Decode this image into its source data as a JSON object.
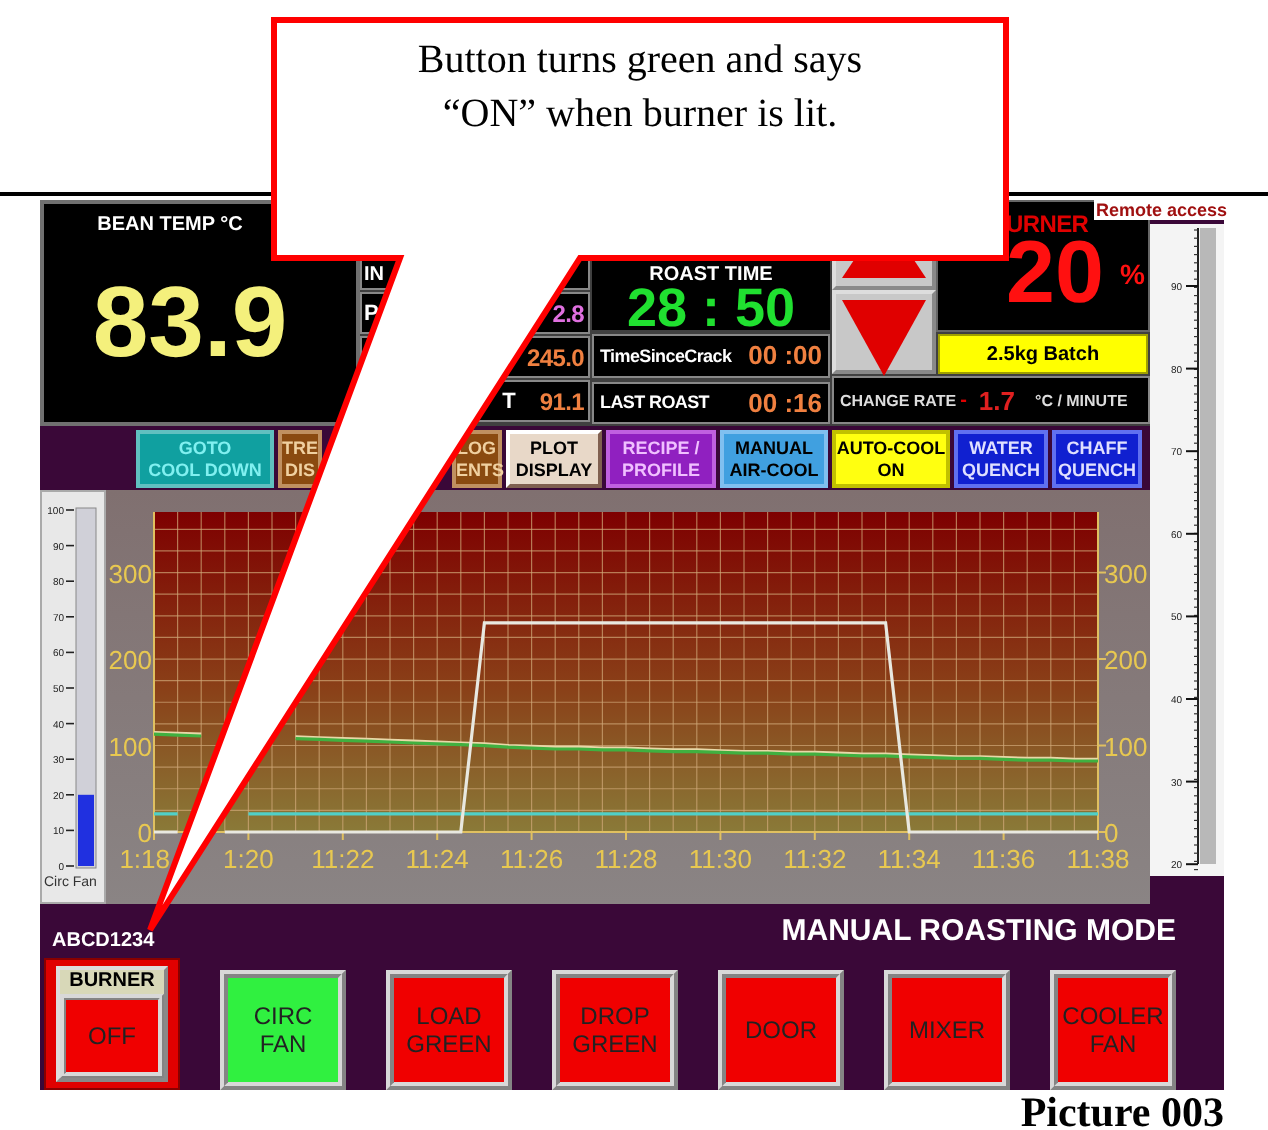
{
  "callout": {
    "lines": [
      "Button turns green and says",
      "“ON” when burner is lit."
    ]
  },
  "bean_temp": {
    "label": "BEAN TEMP °C",
    "value": "83.9"
  },
  "readouts": [
    {
      "kind": "leading",
      "label": "IN"
    },
    {
      "kind": "leading",
      "label": "P",
      "value": "2.8",
      "color": "#e070e0"
    },
    {
      "kind": "leading",
      "value": "245.0",
      "color": "#f08040"
    },
    {
      "kind": "trailing",
      "label": "T",
      "value": "91.1",
      "color": "#f08040"
    }
  ],
  "roast_time": {
    "label": "ROAST TIME",
    "value": "28 : 50"
  },
  "time_since_crack": {
    "label": "TimeSinceCrack",
    "value": "00 :00"
  },
  "last_roast": {
    "label": "LAST ROAST",
    "value": "00 :16"
  },
  "burner": {
    "label": "URNER",
    "value": "20",
    "unit": "%"
  },
  "remote_access": "Remote access",
  "batch": "2.5kg Batch",
  "change_rate": {
    "label": "CHANGE RATE",
    "sign": "-",
    "value": "1.7",
    "unit": "°C / MINUTE"
  },
  "function_buttons": [
    {
      "lines": [
        "GOTO",
        "COOL DOWN"
      ],
      "kind": "teal"
    },
    {
      "lines": [
        "TRE",
        "DIS"
      ],
      "kind": "brown"
    },
    {
      "lines": [
        "LOG",
        "ENTS"
      ],
      "kind": "brown"
    },
    {
      "lines": [
        "PLOT",
        "DISPLAY"
      ],
      "kind": "plot"
    },
    {
      "lines": [
        "RECIPE /",
        "PROFILE"
      ],
      "kind": "violet"
    },
    {
      "lines": [
        "MANUAL",
        "AIR-COOL"
      ],
      "kind": "sky"
    },
    {
      "lines": [
        "AUTO-COOL",
        "ON"
      ],
      "kind": "lemon"
    },
    {
      "lines": [
        "WATER",
        "QUENCH"
      ],
      "kind": "navy"
    },
    {
      "lines": [
        "CHAFF",
        "QUENCH"
      ],
      "kind": "navy"
    }
  ],
  "left_slider": {
    "scale": [
      "100",
      "90",
      "80",
      "70",
      "60",
      "50",
      "40",
      "30",
      "20",
      "10",
      "0"
    ],
    "level": 0.2,
    "label": "Circ Fan"
  },
  "right_gauge": {
    "scale": [
      "90",
      "80",
      "70",
      "60",
      "50",
      "40",
      "30",
      "20"
    ]
  },
  "chart": {
    "left_axis_labels": [
      "300",
      "200",
      "100",
      "0"
    ],
    "right_axis_labels": [
      "300",
      "200",
      "100",
      "0"
    ],
    "chart_data": {
      "type": "line",
      "categories": [
        "1:18",
        null,
        null,
        null,
        "1:20",
        null,
        null,
        null,
        "11:22",
        null,
        null,
        null,
        "11:24",
        null,
        null,
        null,
        "11:26",
        null,
        null,
        null,
        "11:28",
        null,
        null,
        null,
        "11:30",
        null,
        null,
        null,
        "11:32",
        null,
        null,
        null,
        "11:34",
        null,
        null,
        null,
        "11:36",
        null,
        null,
        null,
        "11:38"
      ],
      "series": [
        {
          "color": "#e8d8a8",
          "values": [
            115,
            114,
            113,
            null,
            null,
            null,
            110,
            109,
            108,
            107,
            106,
            105,
            104,
            103,
            102,
            100,
            99,
            98,
            98,
            97,
            97,
            96,
            95,
            95,
            94,
            93,
            93,
            92,
            92,
            91,
            90,
            90,
            89,
            88,
            87,
            87,
            86,
            85,
            85,
            84,
            84
          ]
        },
        {
          "color": "#40b040",
          "values": [
            113,
            112,
            111,
            null,
            null,
            null,
            108,
            107,
            106,
            105,
            104,
            103,
            102,
            101,
            100,
            98,
            97,
            96,
            96,
            95,
            95,
            94,
            93,
            93,
            92,
            91,
            91,
            90,
            90,
            89,
            88,
            88,
            87,
            86,
            85,
            85,
            84,
            83,
            83,
            82,
            82
          ]
        },
        {
          "color": "#50d0c8",
          "values": [
            21,
            21,
            null,
            null,
            21,
            21,
            21,
            21,
            21,
            21,
            21,
            21,
            21,
            21,
            21,
            21,
            21,
            21,
            21,
            21,
            21,
            21,
            21,
            21,
            21,
            21,
            21,
            21,
            21,
            21,
            21,
            21,
            21,
            21,
            21,
            21,
            21,
            21,
            21,
            21,
            21
          ]
        },
        {
          "color": "#e8e8e0",
          "values": [
            0,
            0,
            null,
            0,
            0,
            0,
            0,
            0,
            0,
            0,
            0,
            0,
            0,
            0,
            242,
            242,
            242,
            242,
            242,
            242,
            242,
            242,
            242,
            242,
            242,
            242,
            242,
            242,
            242,
            242,
            242,
            242,
            0,
            0,
            0,
            0,
            0,
            0,
            0,
            0,
            0
          ]
        }
      ],
      "ylim": [
        0,
        370
      ],
      "grid": true,
      "yticks": [
        0,
        100,
        200,
        300
      ]
    }
  },
  "serial": "ABCD1234",
  "mode": "MANUAL ROASTING MODE",
  "control_buttons": [
    {
      "kind": "captioned",
      "caption": "BURNER",
      "lines": [
        "OFF"
      ],
      "on": false
    },
    {
      "kind": "plain",
      "lines": [
        "CIRC",
        "FAN"
      ],
      "on": true
    },
    {
      "kind": "plain",
      "lines": [
        "LOAD",
        "GREEN"
      ],
      "on": false
    },
    {
      "kind": "plain",
      "lines": [
        "DROP",
        "GREEN"
      ],
      "on": false
    },
    {
      "kind": "plain",
      "lines": [
        "DOOR"
      ],
      "on": false
    },
    {
      "kind": "plain",
      "lines": [
        "MIXER"
      ],
      "on": false
    },
    {
      "kind": "plain",
      "lines": [
        "COOLER",
        "FAN"
      ],
      "on": false
    }
  ],
  "caption": "Picture 003"
}
